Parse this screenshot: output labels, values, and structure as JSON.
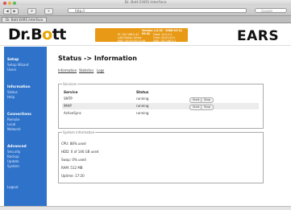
{
  "window": {
    "title": "Dr. Bott EARS Interface"
  },
  "toolbar": {
    "back": "◀",
    "forward": "▶",
    "reload": "⟳",
    "add": "+",
    "url": "http://",
    "search_placeholder": "Google"
  },
  "tab": {
    "label": "Dr. Bott EARS Interface"
  },
  "header": {
    "logo_dr": "Dr.",
    "logo_o": "o",
    "logo_b": "B",
    "logo_tt": "tt",
    "product": "EARS",
    "info": {
      "version_line": "Version 1.0.32 · 2008-02-14 09:32",
      "col1": [
        "IP: 192.168.0.42",
        "LAN Status: Active",
        "MAC: 00:0D:93:12:4A"
      ],
      "col2": [
        "Fixed: 10.0.0.1",
        "Time: 00:01:04 h",
        "DNS: 192.168.0.1"
      ]
    }
  },
  "sidebar": {
    "sections": [
      {
        "title": "Setup",
        "items": [
          "Setup Wizard",
          "Users"
        ]
      },
      {
        "title": "Information",
        "items": [
          "Status",
          "Help"
        ]
      },
      {
        "title": "Connections",
        "items": [
          "Remote",
          "Local",
          "Network"
        ]
      },
      {
        "title": "Advanced",
        "items": [
          "Security",
          "Backup",
          "Update",
          "System"
        ]
      },
      {
        "title": "",
        "items": [
          "Logout"
        ]
      }
    ]
  },
  "main": {
    "title": "Status -> Information",
    "sublinks": [
      "Information",
      "Statistics",
      "Logs"
    ],
    "services": {
      "legend": "Services",
      "headers": [
        "Service",
        "Status"
      ],
      "rows": [
        {
          "service": "SMTP",
          "status": "running",
          "actions": [
            "Start",
            "Stop"
          ]
        },
        {
          "service": "IMAP",
          "status": "running",
          "actions": [
            "Start",
            "Stop"
          ]
        },
        {
          "service": "ActiveSync",
          "status": "running",
          "actions": []
        }
      ]
    },
    "system": {
      "legend": "System information",
      "lines": [
        "CPU: 88% used",
        "HDD: 0 of 146 GB used",
        "Swap: 0% used",
        "RAM: 512 MB",
        "Uptime: 17:20"
      ]
    }
  }
}
